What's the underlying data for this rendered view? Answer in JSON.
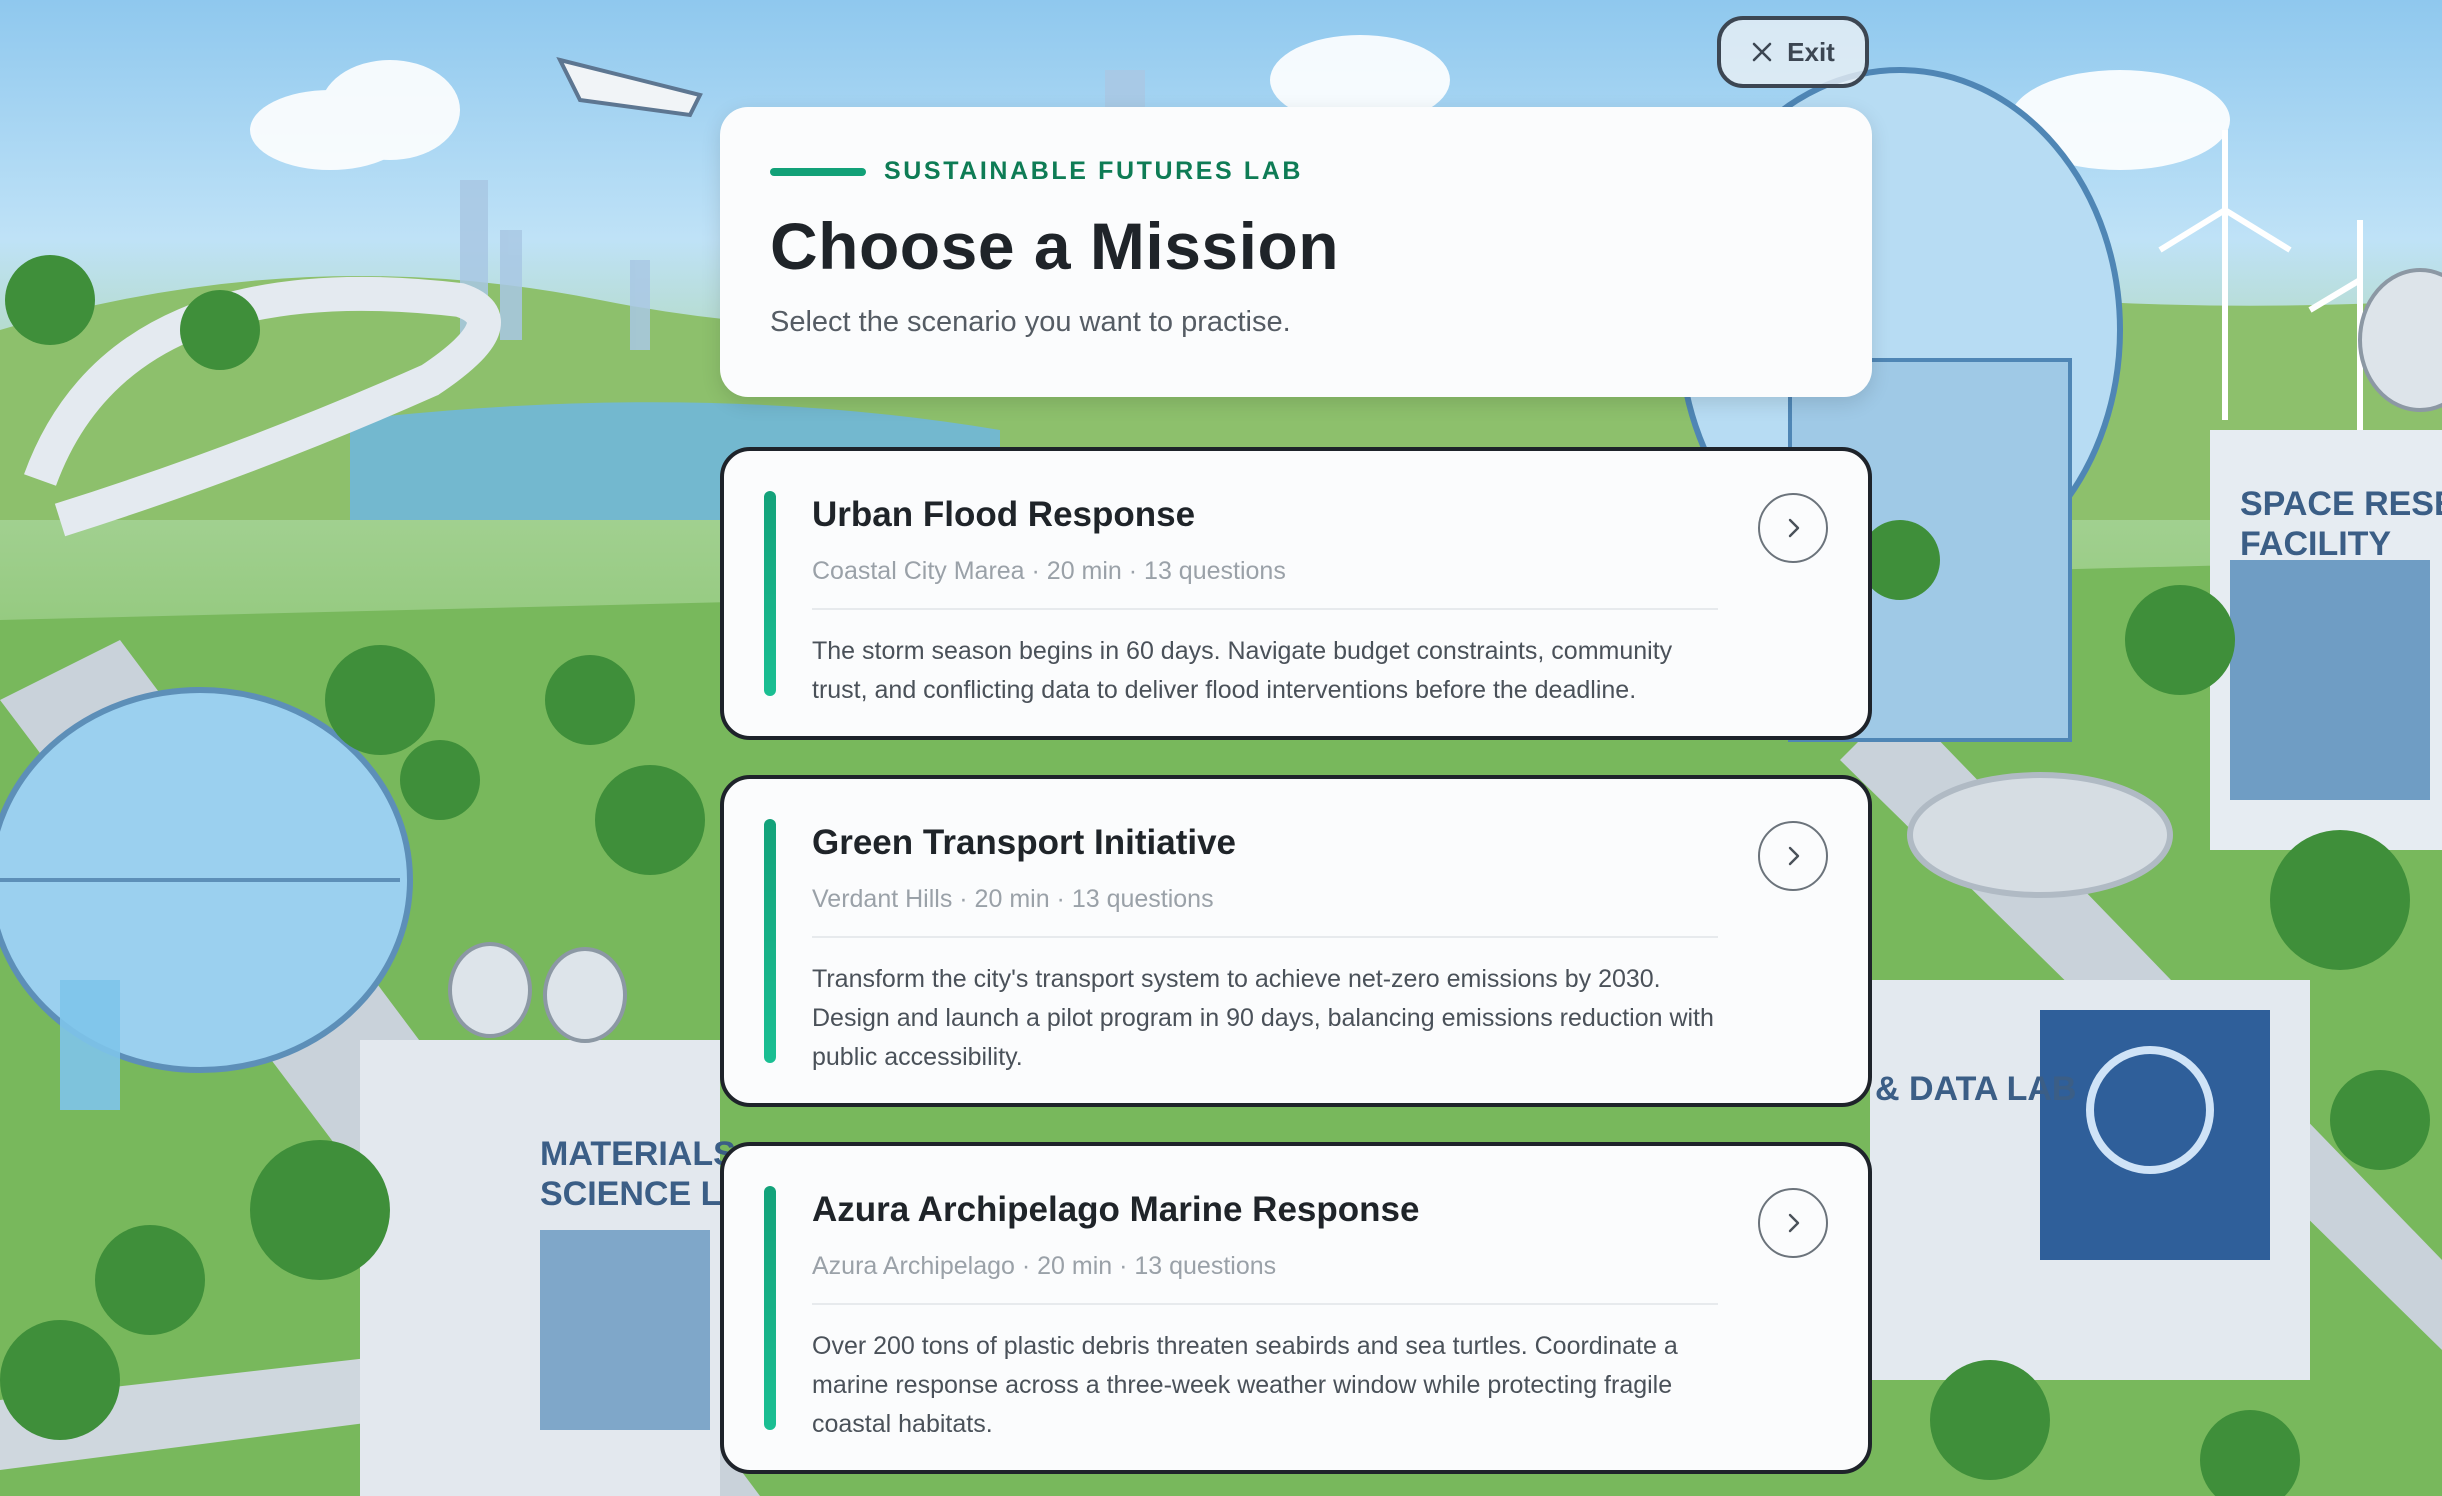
{
  "header": {
    "eyebrow": "SUSTAINABLE FUTURES LAB",
    "title": "Choose a Mission",
    "subtitle": "Select the scenario you want to practise."
  },
  "exit_button": {
    "label": "Exit",
    "icon": "close-icon"
  },
  "background": {
    "signs": [
      "MATERIALS",
      "SCIENCE LAB",
      "SPACE RESEARCH",
      "FACILITY",
      "& DATA LAB"
    ]
  },
  "missions": [
    {
      "title": "Urban Flood Response",
      "meta": "Coastal City Marea · 20 min · 13 questions",
      "description": "The storm season begins in 60 days. Navigate budget constraints, community trust, and conflicting data to deliver flood interventions before the deadline.",
      "icon": "chevron-right-icon"
    },
    {
      "title": "Green Transport Initiative",
      "meta": "Verdant Hills · 20 min · 13 questions",
      "description": "Transform the city's transport system to achieve net-zero emissions by 2030. Design and launch a pilot program in 90 days, balancing emissions reduction with public accessibility.",
      "icon": "chevron-right-icon"
    },
    {
      "title": "Azura Archipelago Marine Response",
      "meta": "Azura Archipelago · 20 min · 13 questions",
      "description": "Over 200 tons of plastic debris threaten seabirds and sea turtles. Coordinate a marine response across a three-week weather window while protecting fragile coastal habitats.",
      "icon": "chevron-right-icon"
    }
  ],
  "colors": {
    "accent": "#12a178",
    "eyebrow_text": "#0e7c55",
    "card_border": "#1e232a",
    "title_text": "#1f2429"
  }
}
